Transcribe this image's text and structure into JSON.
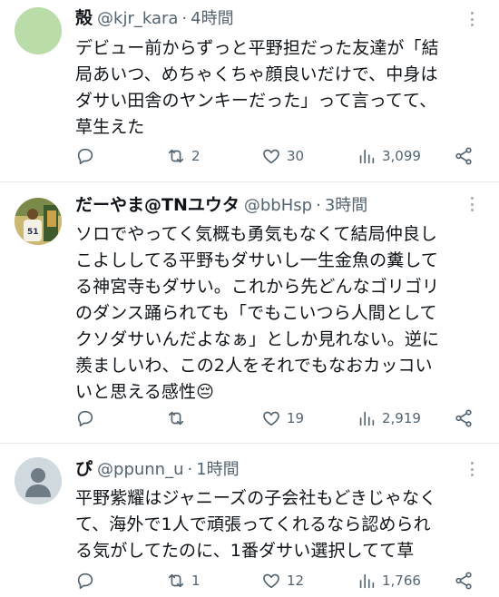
{
  "tweets": [
    {
      "name": "殻",
      "handle": "@kjr_kara",
      "dot": "·",
      "time": "4時間",
      "avatar": "plain-green-avatar",
      "text": "デビュー前からずっと平野担だった友達が「結\n局あいつ、めちゃくちゃ顔良いだけで、中身は\nダサい田舎のヤンキーだった」って言ってて、\n草生えた",
      "replies": "",
      "retweets": "2",
      "likes": "30",
      "views": "3,099"
    },
    {
      "name": "だーやま@TNユウタ",
      "handle": "@bbHsp",
      "dot": "·",
      "time": "3時間",
      "avatar": "baseball-player-avatar",
      "avatar_jersey_number": "51",
      "text": "ソロでやってく気概も勇気もなくて結局仲良し\nこよししてる平野もダサいし一生金魚の糞して\nる神宮寺もダサい。これから先どんなゴリゴリ\nのダンス踊られても「でもこいつら人間として\nクソダサいんだよなぁ」としか見れない。逆に\n羨ましいわ、この2人をそれでもなおカッコい\nいと思える感性😔",
      "replies": "",
      "retweets": "",
      "likes": "19",
      "views": "2,919"
    },
    {
      "name": "ぴ",
      "handle": "@ppunn_u",
      "dot": "·",
      "time": "1時間",
      "avatar": "default-person-avatar",
      "text": "平野紫耀はジャニーズの子会社もどきじゃなく\nて、海外で1人で頑張ってくれるなら認められ\nる気がしてたのに、1番ダサい選択してて草",
      "replies": "",
      "retweets": "1",
      "likes": "12",
      "views": "1,766"
    }
  ],
  "colors": {
    "text": "#0f1419",
    "secondary": "#536471",
    "divider": "#e7e9ea",
    "avatar_green": "#b9dca8"
  },
  "icons": [
    "reply-icon",
    "retweet-icon",
    "like-icon",
    "views-icon",
    "share-icon",
    "more-icon"
  ]
}
